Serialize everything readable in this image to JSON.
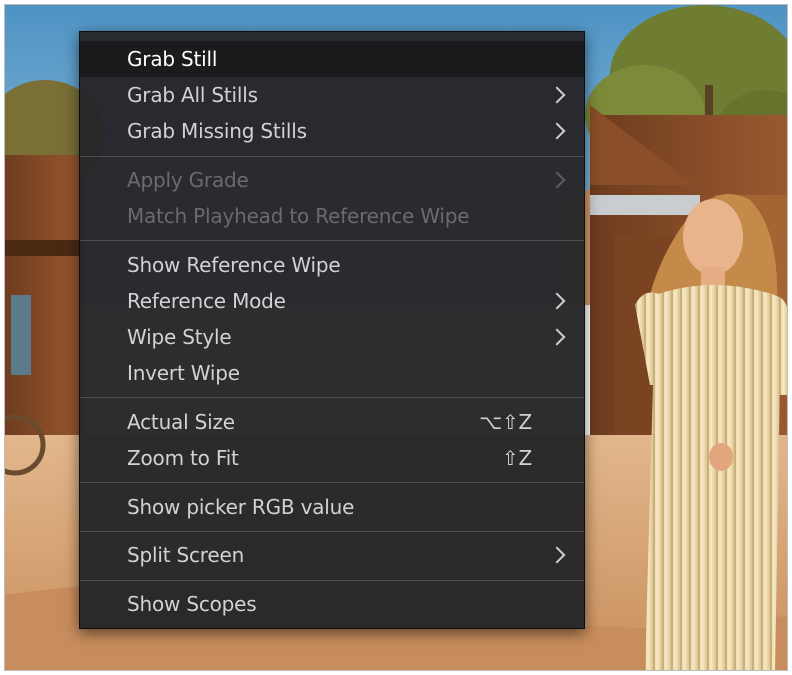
{
  "menu": {
    "items": [
      {
        "label": "Grab Still"
      },
      {
        "label": "Grab All Stills"
      },
      {
        "label": "Grab Missing Stills"
      },
      {
        "label": "Apply Grade"
      },
      {
        "label": "Match Playhead to Reference Wipe"
      },
      {
        "label": "Show Reference Wipe"
      },
      {
        "label": "Reference Mode"
      },
      {
        "label": "Wipe Style"
      },
      {
        "label": "Invert Wipe"
      },
      {
        "label": "Actual Size",
        "shortcut": "⌥⇧Z"
      },
      {
        "label": "Zoom to Fit",
        "shortcut": "⇧Z"
      },
      {
        "label": "Show picker RGB value"
      },
      {
        "label": "Split Screen"
      },
      {
        "label": "Show Scopes"
      }
    ]
  },
  "viewer": {
    "scene": "western town street with woman in striped dress"
  },
  "colors": {
    "menu_bg": "#262629",
    "highlight_bg": "#1b1b1d",
    "text": "#d2d2d2",
    "disabled_text": "#6b6b6e"
  }
}
